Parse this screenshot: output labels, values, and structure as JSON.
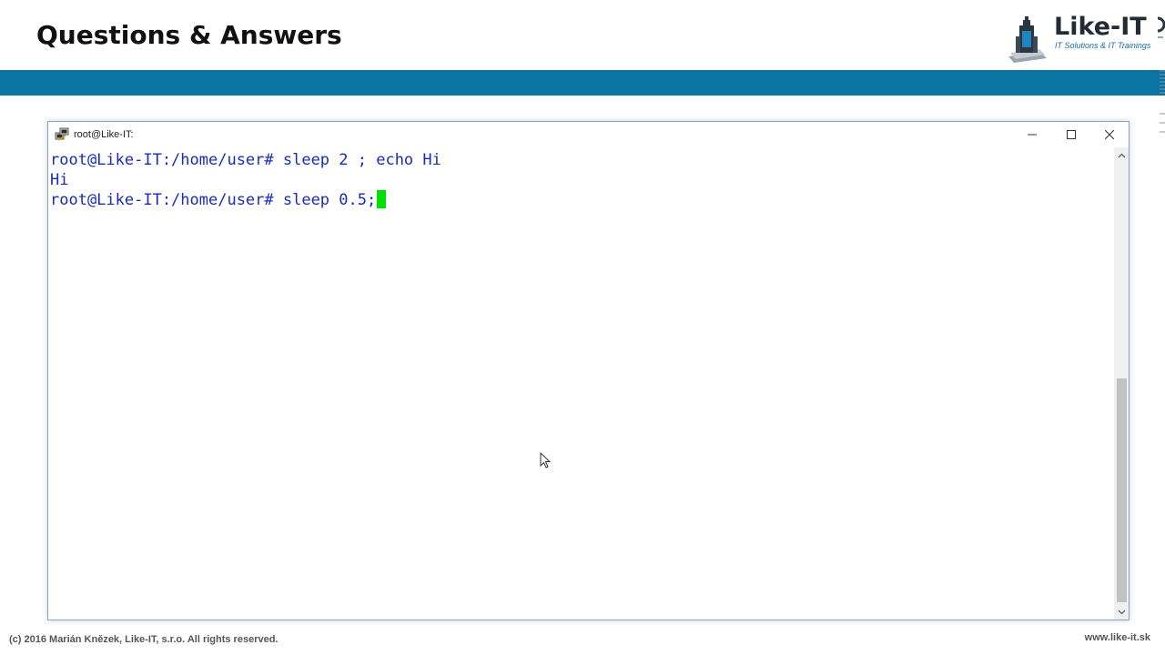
{
  "slide": {
    "title": "Questions & Answers",
    "logo": {
      "name": "Like-IT",
      "tagline": "IT Solutions & IT Trainings",
      "icon": "building-logo-icon"
    },
    "footer": {
      "copyright": "(c) 2016 Marián Knězek, Like-IT, s.r.o. All rights reserved.",
      "website": "www.like-it.sk"
    },
    "colors": {
      "band": "#0a74a3",
      "terminal_text": "#1a2bb8",
      "cursor": "#00e000"
    }
  },
  "window": {
    "title": "root@Like-IT:",
    "app_icon": "putty-icon",
    "controls": {
      "minimize": "minimize-icon",
      "maximize": "maximize-icon",
      "close": "close-icon"
    }
  },
  "terminal": {
    "lines": [
      "root@Like-IT:/home/user# sleep 2 ; echo Hi",
      "Hi",
      "root@Like-IT:/home/user# sleep 0.5;"
    ]
  }
}
